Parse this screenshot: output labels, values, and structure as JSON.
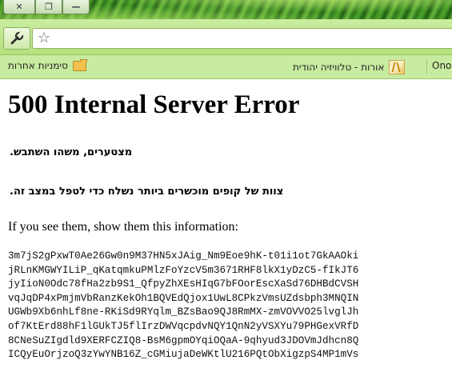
{
  "window": {
    "buttons": [
      {
        "name": "close-button",
        "glyph": "✕"
      },
      {
        "name": "restore-button",
        "glyph": "❐"
      },
      {
        "name": "minimize-button",
        "glyph": "—"
      }
    ]
  },
  "toolbar": {
    "star_glyph": "☆"
  },
  "bookmarks": {
    "other_label": "סימניות אחרות",
    "item_label": "אורות - טלוויזיה יהודית",
    "cut_label": "Ono"
  },
  "page": {
    "heading": "500 Internal Server Error",
    "line1": "מצטערים, משהו השתבש.",
    "line2": "צוות של קופים מוכשרים ביותר נשלח כדי לטפל במצב זה.",
    "line3": "If you see them, show them this information:",
    "code_lines": [
      "3m7jS2gPxwT0Ae26Gw0n9M37HN5xJAig_Nm9Eoe9hK-t01i1ot7GkAAOki",
      "jRLnKMGWYILiP_qKatqmkuPMlzFoYzcV5m3671RHF8lkX1yDzC5-fIkJT6",
      "jyIioN0Odc78fHa2zb9S1_QfpyZhXEsHIqG7bFOorEscXaSd76DHBdCVSH",
      "vqJqDP4xPmjmVbRanzKekOh1BQVEdQjox1UwL8CPkzVmsUZdsbph3MNQIN",
      "UGWb9Xb6nhLf8ne-RKiSd9RYqlm_BZsBao9QJ8RmMX-zmVOVVO25lvglJh",
      "of7KtErd88hF1lGUkTJ5flIrzDWVqcpdvNQY1QnN2yVSXYu79PHGexVRfD",
      "8CNeSuZIgdld9XERFCZIQ8-BsM6gpmOYqiOQaA-9qhyud3JDOVmJdhcn8Q",
      "ICQyEuOrjzoQ3zYwYNB16Z_cGMiujaDeWKtlU216PQtObXigzpS4MP1mVs"
    ]
  }
}
